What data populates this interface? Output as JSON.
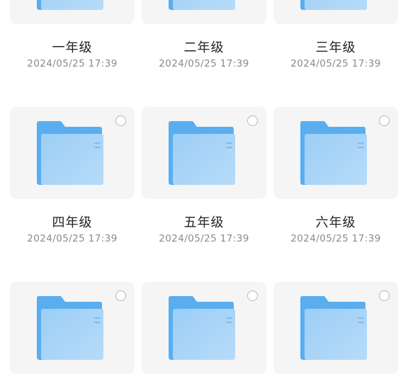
{
  "folders": [
    {
      "name": "一年级",
      "date": "2024/05/25 17:39"
    },
    {
      "name": "二年级",
      "date": "2024/05/25 17:39"
    },
    {
      "name": "三年级",
      "date": "2024/05/25 17:39"
    },
    {
      "name": "四年级",
      "date": "2024/05/25 17:39"
    },
    {
      "name": "五年级",
      "date": "2024/05/25 17:39"
    },
    {
      "name": "六年级",
      "date": "2024/05/25 17:39"
    },
    {
      "name": "",
      "date": ""
    },
    {
      "name": "",
      "date": ""
    },
    {
      "name": "",
      "date": ""
    }
  ],
  "icons": {
    "folder": "folder-icon",
    "select": "select-circle-icon"
  },
  "colors": {
    "folder_back": "#5aaeef",
    "folder_front": "#a9d4f7",
    "tile_bg": "#f5f5f5",
    "name": "#222222",
    "date": "#8a8a8a"
  }
}
